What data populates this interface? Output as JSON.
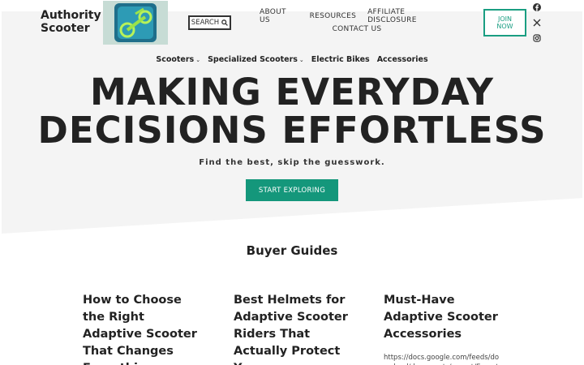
{
  "site": {
    "name_line1": "Authority",
    "name_line2": "Scooter"
  },
  "header": {
    "search_label": "SEARCH",
    "top_links_row1": [
      "ABOUT US",
      "RESOURCES",
      "AFFILIATE DISCLOSURE"
    ],
    "top_links_row2": [
      "CONTACT US"
    ],
    "join_line1": "JOIN",
    "join_line2": "NOW",
    "social_icons": [
      "facebook-icon",
      "x-icon",
      "instagram-icon"
    ]
  },
  "main_nav": [
    {
      "label": "Scooters",
      "has_dropdown": true
    },
    {
      "label": "Specialized Scooters",
      "has_dropdown": true
    },
    {
      "label": "Electric Bikes",
      "has_dropdown": false
    },
    {
      "label": "Accessories",
      "has_dropdown": false
    }
  ],
  "hero": {
    "headline_line1": "MAKING EVERYDAY",
    "headline_line2": "DECISIONS EFFORTLESS",
    "tagline": "Find the best, skip the guesswork.",
    "cta_label": "START EXPLORING"
  },
  "guides": {
    "title": "Buyer Guides",
    "cards": [
      {
        "title": "How to Choose the Right Adaptive Scooter That Changes Everything",
        "url": ""
      },
      {
        "title": "Best Helmets for Adaptive Scooter Riders That Actually Protect You",
        "url": ""
      },
      {
        "title": "Must-Have Adaptive Scooter Accessories",
        "url": "https://docs.google.com/feeds/download/documents/export/Export"
      }
    ]
  },
  "colors": {
    "accent": "#14977b",
    "hero_bg": "#f4f4f4",
    "text": "#222222"
  }
}
